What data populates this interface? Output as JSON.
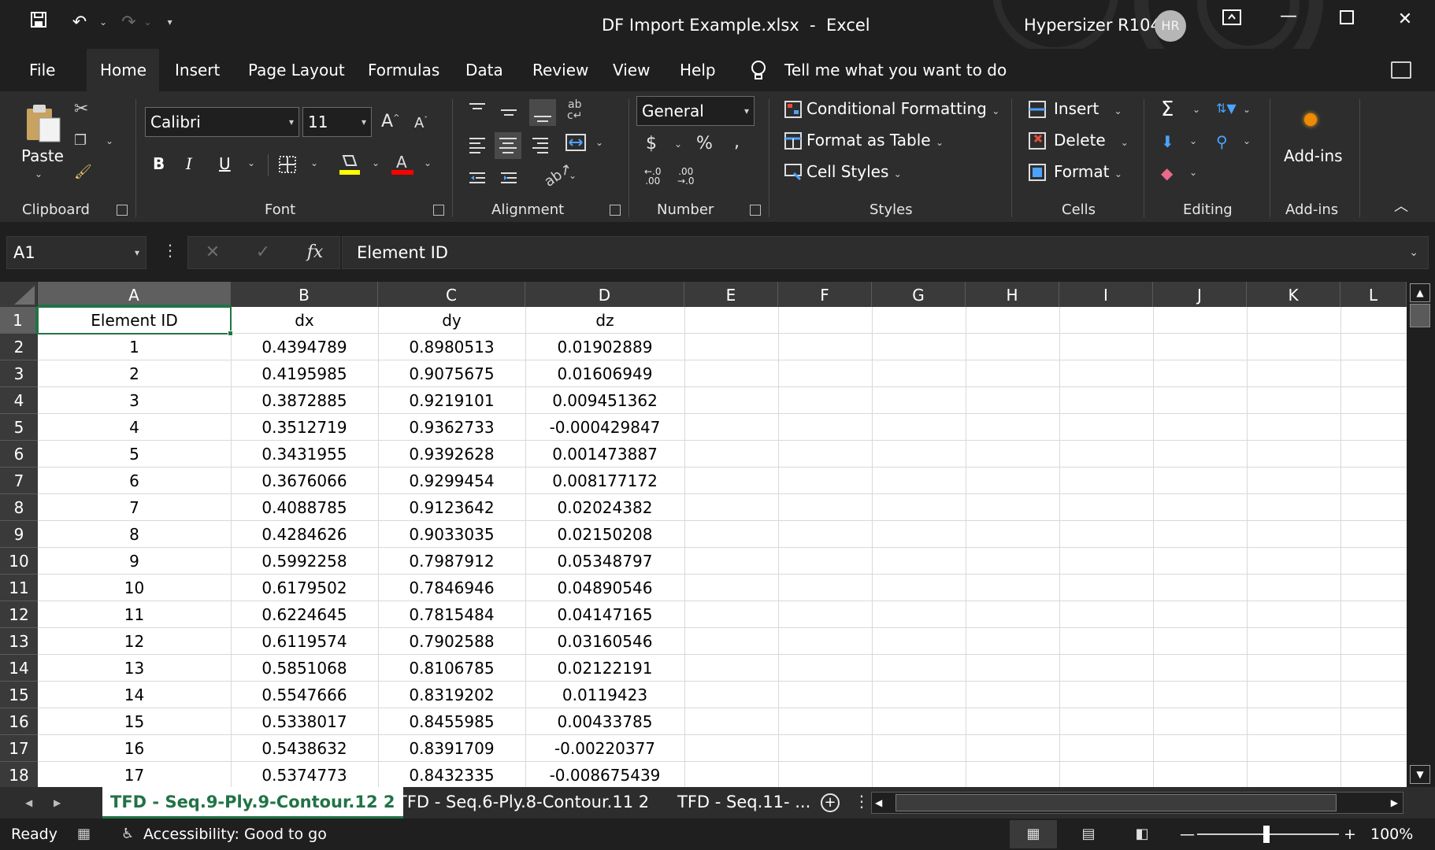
{
  "window": {
    "file_title": "DF Import Example.xlsx  -  Excel",
    "account_name": "Hypersizer R104",
    "avatar_initials": "HR"
  },
  "tabs": [
    {
      "label": "File"
    },
    {
      "label": "Home"
    },
    {
      "label": "Insert"
    },
    {
      "label": "Page Layout"
    },
    {
      "label": "Formulas"
    },
    {
      "label": "Data"
    },
    {
      "label": "Review"
    },
    {
      "label": "View"
    },
    {
      "label": "Help"
    }
  ],
  "tell_me": "Tell me what you want to do",
  "ribbon": {
    "clipboard": {
      "paste": "Paste",
      "label": "Clipboard"
    },
    "font": {
      "name": "Calibri",
      "size": "11",
      "label": "Font"
    },
    "alignment": {
      "label": "Alignment"
    },
    "number": {
      "format": "General",
      "label": "Number"
    },
    "styles": {
      "conditional": "Conditional Formatting",
      "format_table": "Format as Table",
      "cell_styles": "Cell Styles",
      "label": "Styles"
    },
    "cells": {
      "insert": "Insert",
      "delete": "Delete",
      "format": "Format",
      "label": "Cells"
    },
    "editing": {
      "label": "Editing"
    },
    "addins": {
      "button": "Add-ins",
      "label": "Add-ins"
    }
  },
  "formula_bar": {
    "name_box": "A1",
    "formula": "Element ID"
  },
  "columns": [
    "A",
    "B",
    "C",
    "D",
    "E",
    "F",
    "G",
    "H",
    "I",
    "J",
    "K",
    "L"
  ],
  "rows": [
    [
      "Element ID",
      "dx",
      "dy",
      "dz"
    ],
    [
      "1",
      "0.4394789",
      "0.8980513",
      "0.01902889"
    ],
    [
      "2",
      "0.4195985",
      "0.9075675",
      "0.01606949"
    ],
    [
      "3",
      "0.3872885",
      "0.9219101",
      "0.009451362"
    ],
    [
      "4",
      "0.3512719",
      "0.9362733",
      "-0.000429847"
    ],
    [
      "5",
      "0.3431955",
      "0.9392628",
      "0.001473887"
    ],
    [
      "6",
      "0.3676066",
      "0.9299454",
      "0.008177172"
    ],
    [
      "7",
      "0.4088785",
      "0.9123642",
      "0.02024382"
    ],
    [
      "8",
      "0.4284626",
      "0.9033035",
      "0.02150208"
    ],
    [
      "9",
      "0.5992258",
      "0.7987912",
      "0.05348797"
    ],
    [
      "10",
      "0.6179502",
      "0.7846946",
      "0.04890546"
    ],
    [
      "11",
      "0.6224645",
      "0.7815484",
      "0.04147165"
    ],
    [
      "12",
      "0.6119574",
      "0.7902588",
      "0.03160546"
    ],
    [
      "13",
      "0.5851068",
      "0.8106785",
      "0.02122191"
    ],
    [
      "14",
      "0.5547666",
      "0.8319202",
      "0.0119423"
    ],
    [
      "15",
      "0.5338017",
      "0.8455985",
      "0.00433785"
    ],
    [
      "16",
      "0.5438632",
      "0.8391709",
      "-0.00220377"
    ],
    [
      "17",
      "0.5374773",
      "0.8432335",
      "-0.008675439"
    ]
  ],
  "sheets": [
    {
      "label": "TFD - Seq.9-Ply.9-Contour.12 2"
    },
    {
      "label": "TFD - Seq.6-Ply.8-Contour.11 2"
    },
    {
      "label": "TFD - Seq.11- ..."
    }
  ],
  "status": {
    "mode": "Ready",
    "accessibility": "Accessibility: Good to go",
    "zoom": "100%"
  }
}
